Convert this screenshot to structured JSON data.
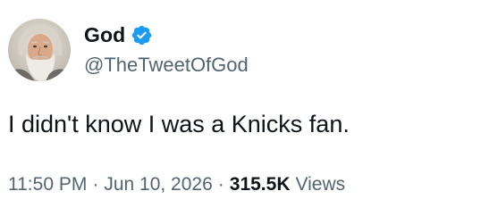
{
  "author": {
    "display_name": "God",
    "handle": "@TheTweetOfGod",
    "verified": true,
    "avatar_icon": "bearded-man-avatar",
    "verified_icon": "verified-badge-icon",
    "verified_color": "#1d9bf0"
  },
  "tweet": {
    "text": "I didn't know I was a Knicks fan."
  },
  "meta": {
    "time": "11:50 PM",
    "separator": "·",
    "date": "Jun 10, 2026",
    "views_count": "315.5K",
    "views_label": "Views"
  },
  "colors": {
    "text_primary": "#0f1419",
    "text_secondary": "#536471",
    "background": "#ffffff"
  }
}
